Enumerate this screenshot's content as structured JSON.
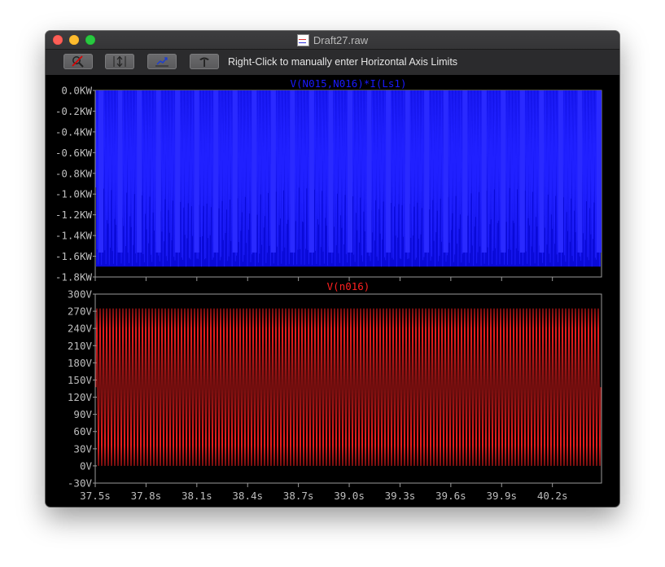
{
  "window": {
    "title": "Draft27.raw",
    "toolbar_hint": "Right-Click to manually enter Horizontal Axis Limits",
    "toolbar_buttons": [
      {
        "name": "zoom-cancel-icon"
      },
      {
        "name": "autorange-vertical-icon"
      },
      {
        "name": "autorange-horizontal-icon"
      },
      {
        "name": "hammer-icon"
      }
    ]
  },
  "chart_data": [
    {
      "type": "line",
      "title": "V(N015,N016)*I(Ls1)",
      "color": "#1a1aff",
      "ylim": [
        -1.8,
        0
      ],
      "yticks": [
        "0.0KW",
        "-0.2KW",
        "-0.4KW",
        "-0.6KW",
        "-0.8KW",
        "-1.0KW",
        "-1.2KW",
        "-1.4KW",
        "-1.6KW",
        "-1.8KW"
      ],
      "signal": {
        "description": "pulsed power, dense waveform",
        "min": -1.7,
        "max": 0.0,
        "unit": "KW"
      }
    },
    {
      "type": "line",
      "title": "V(n016)",
      "color": "#ff2020",
      "ylim": [
        -30,
        300
      ],
      "yticks": [
        "300V",
        "270V",
        "240V",
        "210V",
        "180V",
        "150V",
        "120V",
        "90V",
        "60V",
        "30V",
        "0V",
        "-30V"
      ],
      "signal": {
        "min": 0,
        "max": 275,
        "unit": "V"
      }
    }
  ],
  "x_axis": {
    "ticks": [
      "37.5s",
      "37.8s",
      "38.1s",
      "38.4s",
      "38.7s",
      "39.0s",
      "39.3s",
      "39.6s",
      "39.9s",
      "40.2s"
    ],
    "tick_values": [
      37.5,
      37.8,
      38.1,
      38.4,
      38.7,
      39.0,
      39.3,
      39.6,
      39.9,
      40.2
    ],
    "xlim": [
      37.5,
      40.49
    ]
  }
}
